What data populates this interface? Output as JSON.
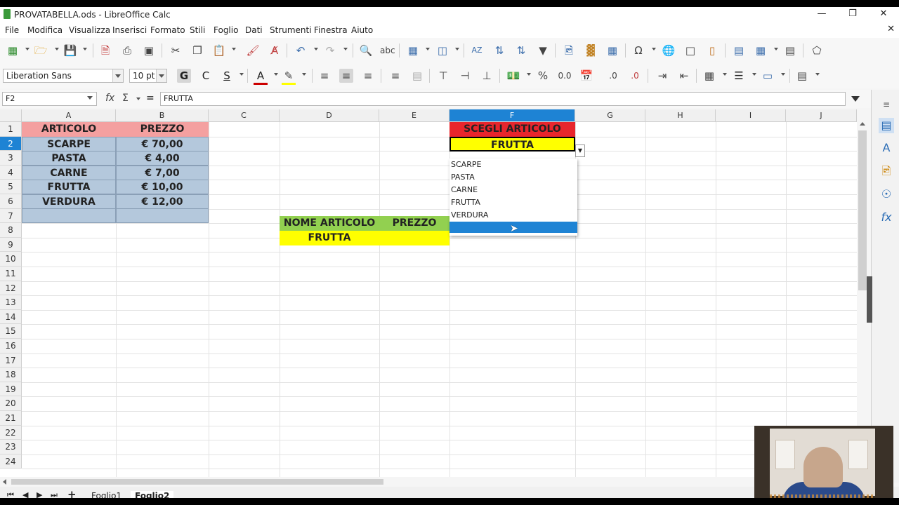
{
  "window": {
    "title": "PROVATABELLA.ods - LibreOffice Calc"
  },
  "menu": [
    "File",
    "Modifica",
    "Visualizza",
    "Inserisci",
    "Formato",
    "Stili",
    "Foglio",
    "Dati",
    "Strumenti",
    "Finestra",
    "Aiuto"
  ],
  "format_toolbar": {
    "font_name": "Liberation Sans",
    "font_size": "10 pt",
    "bold": "G",
    "italic": "C",
    "underline": "S",
    "percent": "%",
    "number_format": "0.0"
  },
  "formula_bar": {
    "cell_ref": "F2",
    "equals": "=",
    "content": "FRUTTA"
  },
  "columns": [
    "A",
    "B",
    "C",
    "D",
    "E",
    "F",
    "G",
    "H",
    "I",
    "J"
  ],
  "selected_column": "F",
  "rows": [
    "1",
    "2",
    "3",
    "4",
    "5",
    "6",
    "7",
    "8",
    "9",
    "10",
    "11",
    "12",
    "13",
    "14",
    "15",
    "16",
    "17",
    "18",
    "19",
    "20",
    "21",
    "22",
    "23",
    "24"
  ],
  "selected_row": "2",
  "table": {
    "header": [
      "ARTICOLO",
      "PREZZO"
    ],
    "rows": [
      [
        "SCARPE",
        "€ 70,00"
      ],
      [
        "PASTA",
        "€ 4,00"
      ],
      [
        "CARNE",
        "€ 7,00"
      ],
      [
        "FRUTTA",
        "€ 10,00"
      ],
      [
        "VERDURA",
        "€ 12,00"
      ]
    ]
  },
  "lookup": {
    "header_name": "NOME ARTICOLO",
    "header_price": "PREZZO",
    "value_name": "FRUTTA",
    "value_price": ""
  },
  "selector": {
    "label": "SCEGLI ARTICOLO",
    "value": "FRUTTA",
    "options": [
      "SCARPE",
      "PASTA",
      "CARNE",
      "FRUTTA",
      "VERDURA"
    ]
  },
  "sheets": [
    "Foglio1",
    "Foglio2"
  ],
  "active_sheet": "Foglio2",
  "colors": {
    "selection": "#1e83d4",
    "header_pink": "#f4a0a0",
    "table_blue": "#b4c8dc",
    "green": "#92d050",
    "yellow": "#ffff00",
    "red": "#e8262c"
  }
}
